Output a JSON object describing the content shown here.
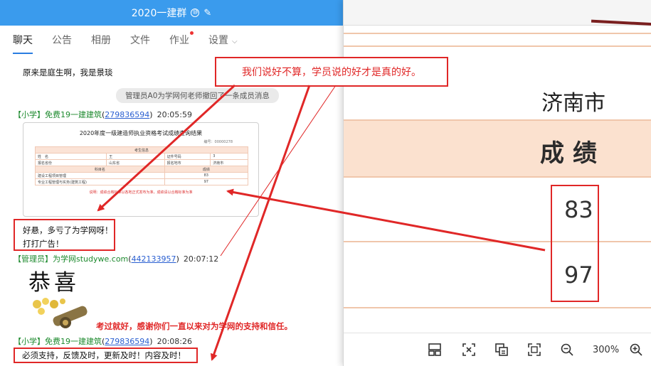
{
  "chat_window": {
    "title": "2020一建群",
    "title_badge": "⑩",
    "tabs": [
      {
        "label": "聊天",
        "active": true
      },
      {
        "label": "公告"
      },
      {
        "label": "相册"
      },
      {
        "label": "文件"
      },
      {
        "label": "作业",
        "dot": true
      },
      {
        "label": "设置"
      }
    ]
  },
  "messages": {
    "first_text": "原来是庭生啊，我是景琰",
    "system_notice": "管理员A0为学网何老师撤回了一条成员消息",
    "msg1": {
      "role": "【小学】",
      "name": "免费19一建建筑",
      "qq": "279836594",
      "time": "20:05:59"
    },
    "result_image": {
      "title": "2020年度一级建造师执业资格考试成绩查询结果",
      "code": "编号：00000278",
      "rows": [
        [
          "考生信息"
        ],
        [
          "姓　名",
          "王",
          "证件号码",
          "3"
        ],
        [
          "报名省份",
          "山东省",
          "报名地市",
          "济南市"
        ],
        [
          "科目名",
          "成绩"
        ],
        [
          "建设工程项目管理",
          "83"
        ],
        [
          "专业工程管理与实务(建筑工程)",
          "97"
        ]
      ],
      "footer": "说明：成绩合格标准以各地正式发布为准，成绩请以合格标准为准"
    },
    "lines": [
      "好悬，多亏了为学网呀！",
      "打打广告！"
    ],
    "msg2": {
      "role": "【管理员】",
      "name": "为学网studywe.com",
      "qq": "442133957",
      "time": "20:07:12"
    },
    "congrats_text": "恭喜",
    "red_caption": "考过就好，感谢你们一直以来对为学网的支持和信任。",
    "msg3": {
      "role": "【小学】",
      "name": "免费19一建建筑",
      "qq": "279836594",
      "time": "20:08:26"
    },
    "last_text": "必须支持，反馈及时，更新及时！内容及时！"
  },
  "annotation": "我们说好不算，学员说的好才是真的好。",
  "viewer": {
    "city": "济南市",
    "score_header": "成绩",
    "scores": [
      "83",
      "97"
    ],
    "zoom": "300%",
    "toolbar_icons": [
      "layout-icon",
      "fit-width-icon",
      "copy-image-icon",
      "fullscreen-icon",
      "zoom-out-icon",
      "zoom-in-icon"
    ]
  },
  "colors": {
    "title_bar": "#3a9bed",
    "annotation_red": "#e02727",
    "peach": "#fbe1cf"
  }
}
